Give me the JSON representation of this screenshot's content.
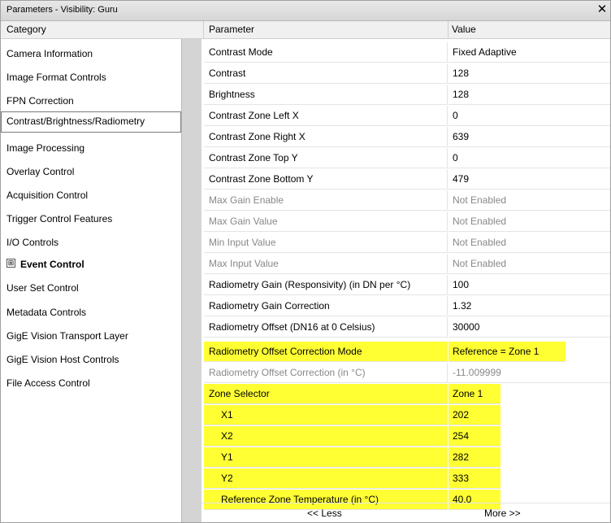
{
  "window": {
    "title": "Parameters - Visibility: Guru",
    "close_icon": "close-icon"
  },
  "headers": {
    "category": "Category",
    "parameter": "Parameter",
    "value": "Value"
  },
  "categories": [
    {
      "label": "Camera Information"
    },
    {
      "label": "Image Format Controls"
    },
    {
      "label": "FPN Correction"
    },
    {
      "label": "Contrast/Brightness/Radiometry"
    },
    {
      "label": "Image Processing"
    },
    {
      "label": "Overlay Control"
    },
    {
      "label": "Acquisition Control"
    },
    {
      "label": "Trigger Control Features"
    },
    {
      "label": "I/O Controls"
    },
    {
      "label": "Event Control",
      "expander": "⊞"
    },
    {
      "label": "User Set Control"
    },
    {
      "label": "Metadata Controls"
    },
    {
      "label": "GigE Vision Transport Layer"
    },
    {
      "label": "GigE Vision Host Controls"
    },
    {
      "label": "File Access Control"
    }
  ],
  "parameters": [
    {
      "name": "Contrast Mode",
      "value": "Fixed Adaptive"
    },
    {
      "name": "Contrast",
      "value": "128"
    },
    {
      "name": "Brightness",
      "value": "128"
    },
    {
      "name": "Contrast Zone Left X",
      "value": "0"
    },
    {
      "name": "Contrast Zone Right X",
      "value": "639"
    },
    {
      "name": "Contrast Zone Top Y",
      "value": "0"
    },
    {
      "name": "Contrast Zone Bottom Y",
      "value": "479"
    },
    {
      "name": "Max Gain Enable",
      "value": "Not Enabled"
    },
    {
      "name": "Max Gain Value",
      "value": "Not Enabled"
    },
    {
      "name": "Min Input Value",
      "value": "Not Enabled"
    },
    {
      "name": "Max Input Value",
      "value": "Not Enabled"
    },
    {
      "name": "Radiometry Gain (Responsivity) (in DN per °C)",
      "value": "100"
    },
    {
      "name": "Radiometry Gain Correction",
      "value": "1.32"
    },
    {
      "name": "Radiometry Offset (DN16 at 0 Celsius)",
      "value": "30000"
    },
    {
      "name": "Radiometry Offset Correction Mode",
      "value": "Reference = Zone 1"
    },
    {
      "name": "Radiometry Offset Correction (in °C)",
      "value": "-11.009999"
    },
    {
      "name": "Zone Selector",
      "value": "Zone 1"
    },
    {
      "name": "X1",
      "value": "202"
    },
    {
      "name": "X2",
      "value": "254"
    },
    {
      "name": "Y1",
      "value": "282"
    },
    {
      "name": "Y2",
      "value": "333"
    },
    {
      "name": "Reference Zone Temperature (in °C)",
      "value": "40.0"
    }
  ],
  "footer": {
    "less": "<< Less",
    "more": "More >>"
  },
  "colors": {
    "highlight": "#ffff33",
    "disabled_text": "#888888",
    "gutter": "#d4d4d4"
  }
}
